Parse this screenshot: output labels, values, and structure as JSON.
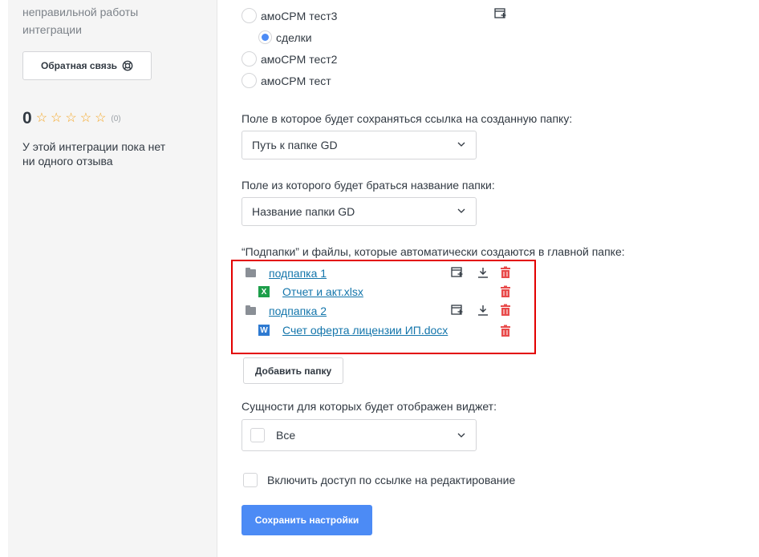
{
  "sidebar": {
    "problem_text_line1": "неправильной работы",
    "problem_text_line2": "интеграции",
    "feedback_button": "Обратная связь",
    "rating_value": "0",
    "rating_count": "(0)",
    "stars_filled": 0,
    "stars_total": 5,
    "no_reviews_line1": "У этой интеграции пока нет",
    "no_reviews_line2": "ни одного отзыва"
  },
  "radios": [
    {
      "label": "амоCPM тест3",
      "checked": false
    },
    {
      "label": "сделки",
      "checked": true
    },
    {
      "label": "амоCPM тест2",
      "checked": false
    },
    {
      "label": "амоCPM тест",
      "checked": false
    }
  ],
  "link_field": {
    "label": "Поле в которое будет сохраняться ссылка на созданную папку:",
    "value": "Путь к папке GD"
  },
  "name_field": {
    "label": "Поле из которого будет браться название папки:",
    "value": "Название папки GD"
  },
  "subfolders": {
    "label": "“Подпапки” и файлы, которые автоматически создаются в главной папке:",
    "items": [
      {
        "type": "folder",
        "name": "подпапка 1"
      },
      {
        "type": "xlsx",
        "name": "Отчет и акт.xlsx"
      },
      {
        "type": "folder",
        "name": "подпапка 2"
      },
      {
        "type": "docx",
        "name": "Счет оферта лицензии ИП.docx"
      }
    ],
    "xlsx_icon_letter": "X",
    "docx_icon_letter": "W"
  },
  "add_folder_button": "Добавить папку",
  "entities": {
    "label": "Сущности для которых будет отображен виджет:",
    "value": "Все"
  },
  "edit_access_label": "Включить доступ по ссылке на редактирование",
  "save_button": "Сохранить настройки",
  "colors": {
    "accent": "#4c8bf5",
    "link": "#1375ab",
    "delete": "#e84a4a",
    "highlight_box": "#e30000",
    "star": "#f5a623"
  }
}
